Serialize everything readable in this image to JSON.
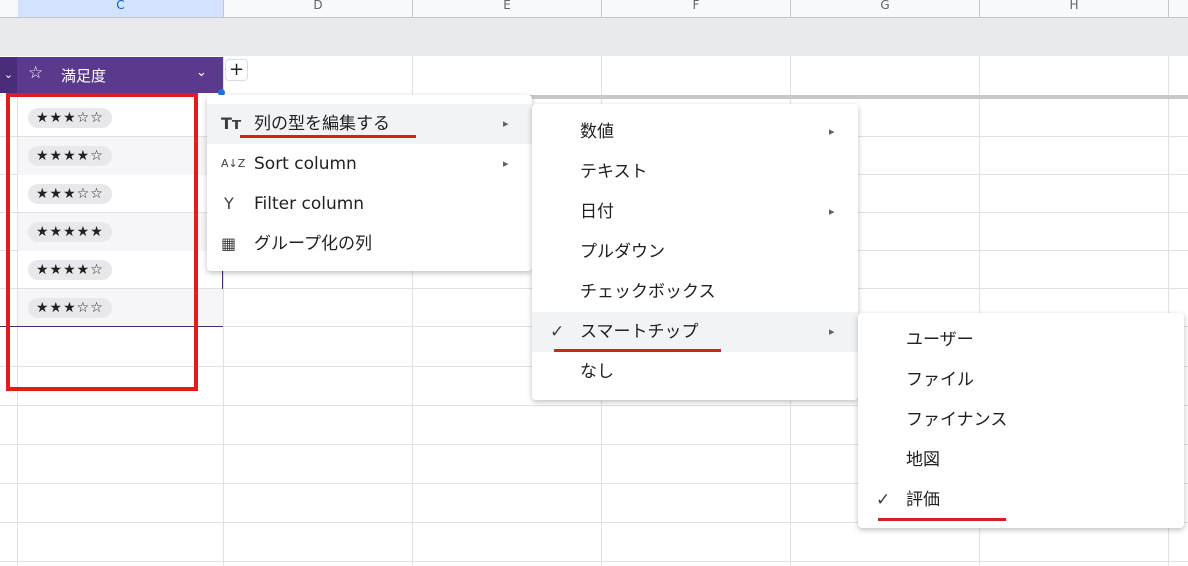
{
  "columns": [
    "C",
    "D",
    "E",
    "F",
    "G",
    "H"
  ],
  "table": {
    "header_title": "満足度",
    "header_icon": "star-outline-icon",
    "add_button_label": "+",
    "ratings": [
      "★★★☆☆",
      "★★★★☆",
      "★★★☆☆",
      "★★★★★",
      "★★★★☆",
      "★★★☆☆"
    ],
    "rating_values": [
      3,
      4,
      3,
      5,
      4,
      3
    ]
  },
  "context_menu": {
    "items": [
      {
        "icon": "Tт",
        "icon_name": "text-type-icon",
        "label": "列の型を編集する",
        "submenu": "▸"
      },
      {
        "icon": "A↓Z",
        "icon_name": "sort-az-icon",
        "label": "Sort column",
        "submenu": "▸"
      },
      {
        "icon": "Y",
        "icon_name": "filter-icon",
        "label": "Filter column"
      },
      {
        "icon": "▦",
        "icon_name": "group-table-icon",
        "label": "グループ化の列"
      }
    ]
  },
  "type_menu": {
    "items": [
      {
        "label": "数値",
        "submenu": "▸"
      },
      {
        "label": "テキスト"
      },
      {
        "label": "日付",
        "submenu": "▸"
      },
      {
        "label": "プルダウン"
      },
      {
        "label": "チェックボックス"
      },
      {
        "label": "スマートチップ",
        "submenu": "▸",
        "checked": true
      },
      {
        "label": "なし"
      }
    ]
  },
  "chip_menu": {
    "items": [
      {
        "label": "ユーザー"
      },
      {
        "label": "ファイル"
      },
      {
        "label": "ファイナンス"
      },
      {
        "label": "地図"
      },
      {
        "label": "評価",
        "checked": true
      }
    ]
  },
  "glyphs": {
    "check": "✓",
    "chevron": "⌄",
    "star": "☆"
  },
  "colors": {
    "header_bg": "#5b3a8e",
    "highlight_red": "#e21b1b",
    "selected_col": "#d3e3fd"
  }
}
